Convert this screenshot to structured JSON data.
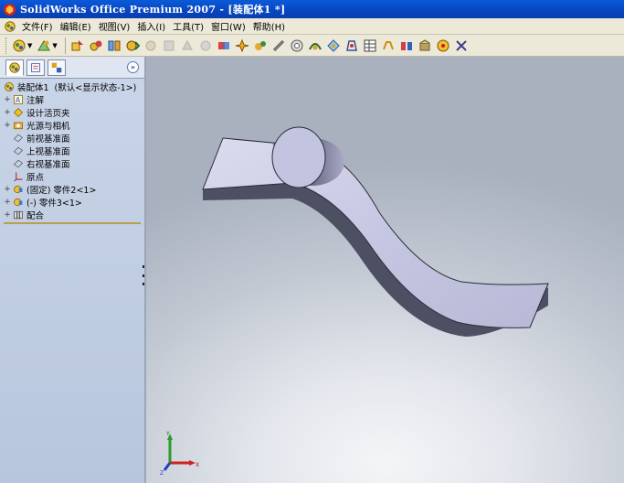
{
  "window": {
    "title": "SolidWorks Office Premium 2007 - [装配体1 *]"
  },
  "menu": {
    "items": [
      "文件(F)",
      "编辑(E)",
      "视图(V)",
      "插入(I)",
      "工具(T)",
      "窗口(W)",
      "帮助(H)"
    ]
  },
  "toolbar": {
    "icons": [
      "assembly-icon",
      "view-orientation-icon",
      "insert-component-icon",
      "hide-show-icon",
      "mate-icon",
      "move-component-icon",
      "rotate-component-icon",
      "smart-fasteners-icon",
      "exploded-view-icon",
      "explode-line-icon",
      "interference-icon",
      "collision-icon",
      "physical-dynamics-icon",
      "clearance-icon",
      "hole-series-icon",
      "assembly-feature-icon",
      "reference-geometry-icon",
      "sketch-icon",
      "bom-icon",
      "instant3d-icon",
      "toolbox-icon"
    ]
  },
  "feature_tree": {
    "root": {
      "name": "装配体1",
      "config": "(默认<显示状态-1>)"
    },
    "items": [
      {
        "label": "注解",
        "icon": "annotations-icon",
        "expandable": true
      },
      {
        "label": "设计活页夹",
        "icon": "design-binder-icon",
        "expandable": true
      },
      {
        "label": "光源与相机",
        "icon": "lights-cameras-icon",
        "expandable": true
      },
      {
        "label": "前视基准面",
        "icon": "plane-icon",
        "expandable": false
      },
      {
        "label": "上视基准面",
        "icon": "plane-icon",
        "expandable": false
      },
      {
        "label": "右视基准面",
        "icon": "plane-icon",
        "expandable": false
      },
      {
        "label": "原点",
        "icon": "origin-icon",
        "expandable": false
      },
      {
        "label": "(固定) 零件2<1>",
        "icon": "part-icon",
        "expandable": true
      },
      {
        "label": "(-) 零件3<1>",
        "icon": "part-icon",
        "expandable": true
      },
      {
        "label": "配合",
        "icon": "mates-icon",
        "expandable": true
      }
    ]
  },
  "triad": {
    "x_label": "X",
    "y_label": "Y",
    "z_label": "Z"
  },
  "colors": {
    "titlebar": "#0a4fd0",
    "panel_bg": "#c3d0e5",
    "part_face": "#c9cbe4",
    "part_dark": "#4d4f63",
    "rollback_bar": "#b7a046"
  }
}
